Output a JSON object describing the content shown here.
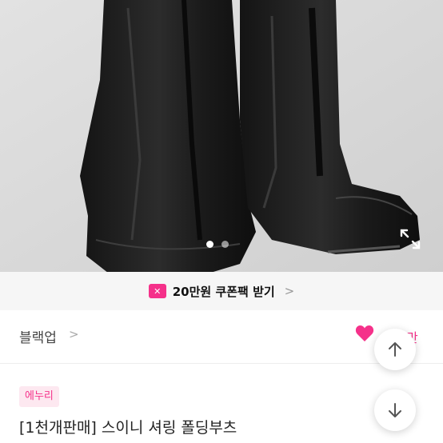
{
  "carousel": {
    "total": 2,
    "active": 0
  },
  "coupon": {
    "icon": "coupon-ticket-icon",
    "text": "20만원 쿠폰팩 받기",
    "chevron": ">"
  },
  "shop": {
    "name": "블랙업",
    "chevron": ">"
  },
  "like": {
    "count_fragment": "만",
    "color": "#f5318a"
  },
  "product": {
    "badge": "에누리",
    "title": "[1천개판매] 스이니 셔링 폴딩부츠"
  },
  "colors": {
    "accent": "#f5318a",
    "badge_bg": "#fde8f0",
    "coupon_bar_bg": "#f6f6f6"
  }
}
